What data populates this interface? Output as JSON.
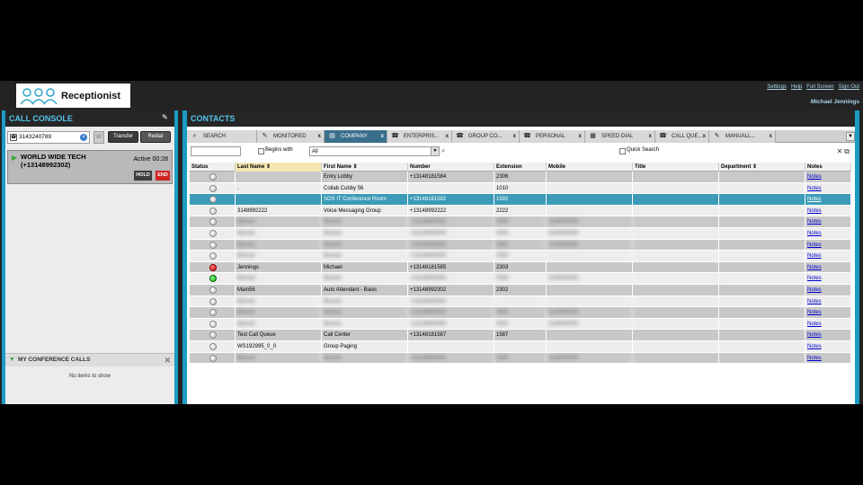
{
  "header": {
    "brand": "Receptionist",
    "links": [
      "Settings",
      "Help",
      "Full Screen",
      "Sign Out"
    ],
    "user": "Michael Jennings"
  },
  "call_console": {
    "title": "CALL CONSOLE",
    "dial_value": "3143240789",
    "transfer_label": "Transfer",
    "redial_label": "Redial",
    "call": {
      "name": "WORLD WIDE TECH",
      "number": "(+13148992302)",
      "status": "Active 00:28",
      "hold_label": "HOLD",
      "end_label": "END"
    },
    "conference": {
      "title": "MY CONFERENCE CALLS",
      "empty": "No items to show"
    }
  },
  "contacts": {
    "title": "CONTACTS",
    "tabs": [
      {
        "label": "SEARCH",
        "icon": "search-icon",
        "closable": false
      },
      {
        "label": "MONITORED",
        "icon": "pencil-icon",
        "closable": true
      },
      {
        "label": "COMPANY",
        "icon": "building-icon",
        "closable": true,
        "active": true
      },
      {
        "label": "ENTERPRIS...",
        "icon": "phone-icon",
        "closable": true
      },
      {
        "label": "GROUP CO...",
        "icon": "phone-icon",
        "closable": true
      },
      {
        "label": "PERSONAL",
        "icon": "phone-icon",
        "closable": true
      },
      {
        "label": "SPEED DIAL",
        "icon": "grid-icon",
        "closable": true
      },
      {
        "label": "CALL QUE...",
        "icon": "phone-icon",
        "closable": true
      },
      {
        "label": "MANUALL...",
        "icon": "pencil-icon",
        "closable": true
      }
    ],
    "filter": {
      "begins_with_label": "Begins with",
      "all_value": "All",
      "quick_search_label": "Quick Search"
    },
    "columns": [
      "Status",
      "Last Name",
      "First Name",
      "Number",
      "Extension",
      "Mobile",
      "Title",
      "Department",
      "Notes"
    ],
    "rows": [
      {
        "status": "grey",
        "last": "",
        "first": "Entry Lobby",
        "number": "+13148181584",
        "ext": "2306",
        "mobile": "",
        "notes": "Notes"
      },
      {
        "status": "grey",
        "last": ".",
        "first": "Collab Cubby 56",
        "number": "",
        "ext": "1010",
        "mobile": "",
        "notes": "Notes"
      },
      {
        "status": "grey",
        "last": "",
        "first": "SOS IT Conference Room",
        "number": "+13148181592",
        "ext": "1592",
        "mobile": "",
        "notes": "Notes",
        "selected": true
      },
      {
        "status": "grey",
        "last": "3148992222",
        "first": "Voice Messaging Group",
        "number": "+13148992222",
        "ext": "2222",
        "mobile": "",
        "notes": "Notes"
      },
      {
        "status": "grey",
        "last": "Blurred",
        "first": "Blurred",
        "number": "+13148000000",
        "ext": "0000",
        "mobile": "3140000000",
        "notes": "Notes",
        "blurred": true
      },
      {
        "status": "grey",
        "last": "Blurred",
        "first": "Blurred",
        "number": "+13148000000",
        "ext": "0000",
        "mobile": "3140000000",
        "notes": "Notes",
        "blurred": true
      },
      {
        "status": "grey",
        "last": "Blurred",
        "first": "Blurred",
        "number": "+13148000000",
        "ext": "0000",
        "mobile": "3140000000",
        "notes": "Notes",
        "blurred": true
      },
      {
        "status": "grey",
        "last": "Blurred",
        "first": "Blurred",
        "number": "+13148000000",
        "ext": "0000",
        "mobile": "",
        "notes": "Notes",
        "blurred": true
      },
      {
        "status": "red",
        "last": "Jennings",
        "first": "Michael",
        "number": "+13148181585",
        "ext": "2303",
        "mobile": "",
        "notes": "Notes"
      },
      {
        "status": "green",
        "last": "Blurred",
        "first": "Blurred",
        "number": "+13148000000",
        "ext": "0000",
        "mobile": "3140000000",
        "notes": "Notes",
        "blurred": true
      },
      {
        "status": "grey",
        "last": "Main56",
        "first": "Auto Attendant - Basic",
        "number": "+13148992302",
        "ext": "2302",
        "mobile": "",
        "notes": "Notes"
      },
      {
        "status": "grey",
        "last": "Blurred",
        "first": "Blurred",
        "number": "+13148000000",
        "ext": "",
        "mobile": "",
        "notes": "Notes",
        "blurred": true
      },
      {
        "status": "grey",
        "last": "Blurred",
        "first": "Blurred",
        "number": "+13148000000",
        "ext": "0000",
        "mobile": "3140000000",
        "notes": "Notes",
        "blurred": true
      },
      {
        "status": "grey",
        "last": "Blurred",
        "first": "Blurred",
        "number": "+13148000000",
        "ext": "0000",
        "mobile": "3140000000",
        "notes": "Notes",
        "blurred": true
      },
      {
        "status": "grey",
        "last": "Test Call Queue",
        "first": "Call Center",
        "number": "+13148181587",
        "ext": "1587",
        "mobile": "",
        "notes": "Notes"
      },
      {
        "status": "grey",
        "last": "WS192995_0_0",
        "first": "Group Paging",
        "number": "",
        "ext": "",
        "mobile": "",
        "notes": "Notes"
      },
      {
        "status": "grey",
        "last": "Blurred",
        "first": "Blurred",
        "number": "+13148000000",
        "ext": "0000",
        "mobile": "3140000000",
        "notes": "Notes",
        "blurred": true
      }
    ]
  }
}
